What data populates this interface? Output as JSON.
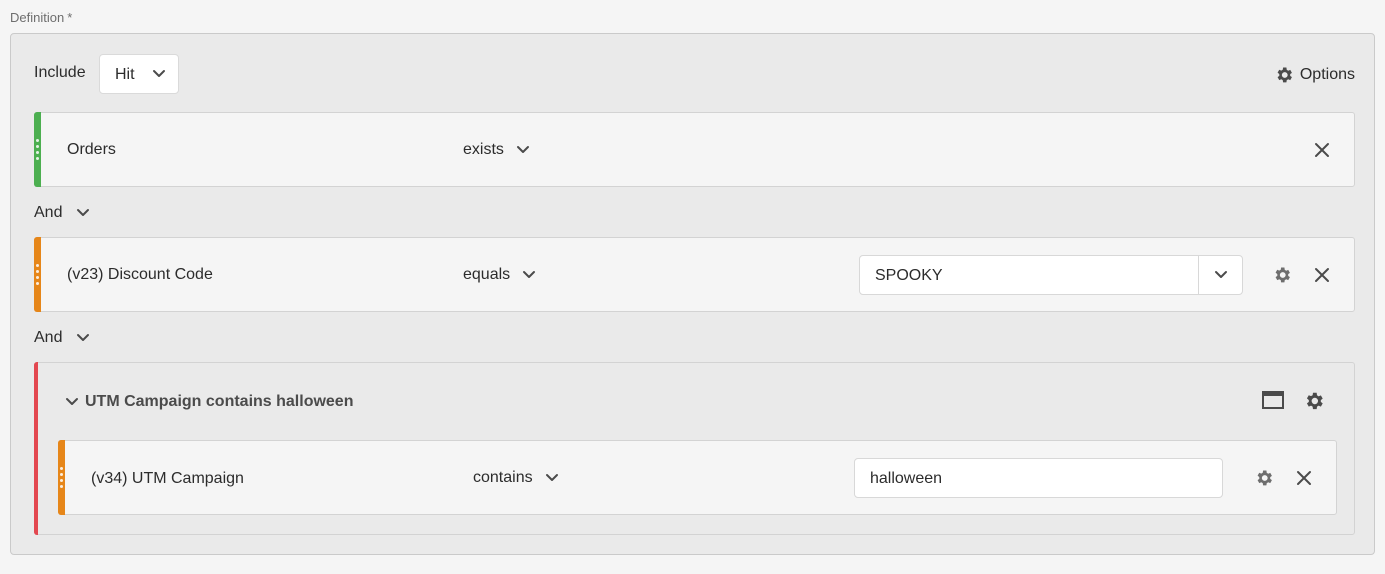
{
  "definition": {
    "label": "Definition",
    "required_mark": "*"
  },
  "header": {
    "include_label": "Include",
    "context_value": "Hit",
    "options_label": "Options"
  },
  "rules": [
    {
      "dimension": "Orders",
      "operator": "exists",
      "bar_color": "#4caf50"
    },
    {
      "dimension": "(v23) Discount Code",
      "operator": "equals",
      "value": "SPOOKY",
      "bar_color": "#e68619"
    }
  ],
  "conjunctions": [
    "And",
    "And"
  ],
  "container": {
    "title": "UTM Campaign contains halloween",
    "bar_color": "#e34850",
    "rule": {
      "dimension": "(v34) UTM Campaign",
      "operator": "contains",
      "value": "halloween",
      "bar_color": "#e68619"
    }
  },
  "icons": {
    "gear": "gear-icon",
    "close": "close-icon",
    "chevron": "chevron-down-icon",
    "window": "window-icon",
    "drag": "drag-handle-icon"
  }
}
